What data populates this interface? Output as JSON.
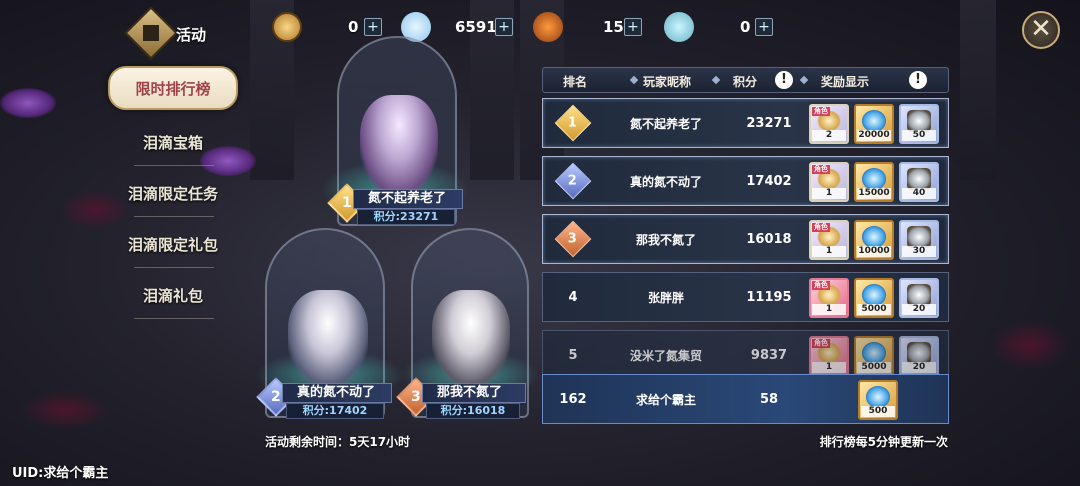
{
  "top_bar": {
    "activity_label": "活动",
    "resources": [
      {
        "icon": "ticket-icon",
        "value": "0"
      },
      {
        "icon": "slime-icon",
        "value": "6591"
      },
      {
        "icon": "orange-key-icon",
        "value": "15"
      },
      {
        "icon": "blue-key-icon",
        "value": "0"
      }
    ],
    "plus_symbol": "+",
    "close_symbol": "✕"
  },
  "menu": {
    "items": [
      {
        "label": "限时排行榜",
        "active": true
      },
      {
        "label": "泪滴宝箱"
      },
      {
        "label": "泪滴限定任务"
      },
      {
        "label": "泪滴限定礼包"
      },
      {
        "label": "泪滴礼包"
      }
    ]
  },
  "podium": [
    {
      "rank": "1",
      "name": "氮不起养老了",
      "score": "积分:23271"
    },
    {
      "rank": "2",
      "name": "真的氮不动了",
      "score": "积分:17402"
    },
    {
      "rank": "3",
      "name": "那我不氮了",
      "score": "积分:16018"
    }
  ],
  "remaining_time": "活动剩余时间：5天17小时",
  "uid": "UID:求给个霸主",
  "table": {
    "headers": {
      "rank": "排名",
      "player": "玩家昵称",
      "score": "积分",
      "reward": "奖励显示",
      "info": "!"
    },
    "rows": [
      {
        "rank": "1",
        "name": "氮不起养老了",
        "score": "23271",
        "rewards": [
          {
            "type": "scroll",
            "tag": "角色",
            "count": "2"
          },
          {
            "type": "gem",
            "count": "20000"
          },
          {
            "type": "sword",
            "count": "50"
          }
        ]
      },
      {
        "rank": "2",
        "name": "真的氮不动了",
        "score": "17402",
        "rewards": [
          {
            "type": "scroll",
            "tag": "角色",
            "count": "1"
          },
          {
            "type": "gem",
            "count": "15000"
          },
          {
            "type": "sword",
            "count": "40"
          }
        ]
      },
      {
        "rank": "3",
        "name": "那我不氮了",
        "score": "16018",
        "rewards": [
          {
            "type": "scroll",
            "tag": "角色",
            "count": "1"
          },
          {
            "type": "gem",
            "count": "10000"
          },
          {
            "type": "sword",
            "count": "30"
          }
        ]
      },
      {
        "rank": "4",
        "name": "张胖胖",
        "score": "11195",
        "rewards": [
          {
            "type": "scroll-red",
            "tag": "角色",
            "count": "1"
          },
          {
            "type": "gem",
            "count": "5000"
          },
          {
            "type": "sword",
            "count": "20"
          }
        ]
      },
      {
        "rank": "5",
        "name": "没米了氮集贸",
        "score": "9837",
        "rewards": [
          {
            "type": "scroll-red",
            "tag": "角色",
            "count": "1"
          },
          {
            "type": "gem",
            "count": "5000"
          },
          {
            "type": "sword",
            "count": "20"
          }
        ]
      },
      {
        "rank": "162",
        "name": "求给个霸主",
        "score": "58",
        "rewards": [
          {
            "type": "gem",
            "count": "500"
          }
        ]
      }
    ]
  },
  "refresh_note": "排行榜每5分钟更新一次"
}
